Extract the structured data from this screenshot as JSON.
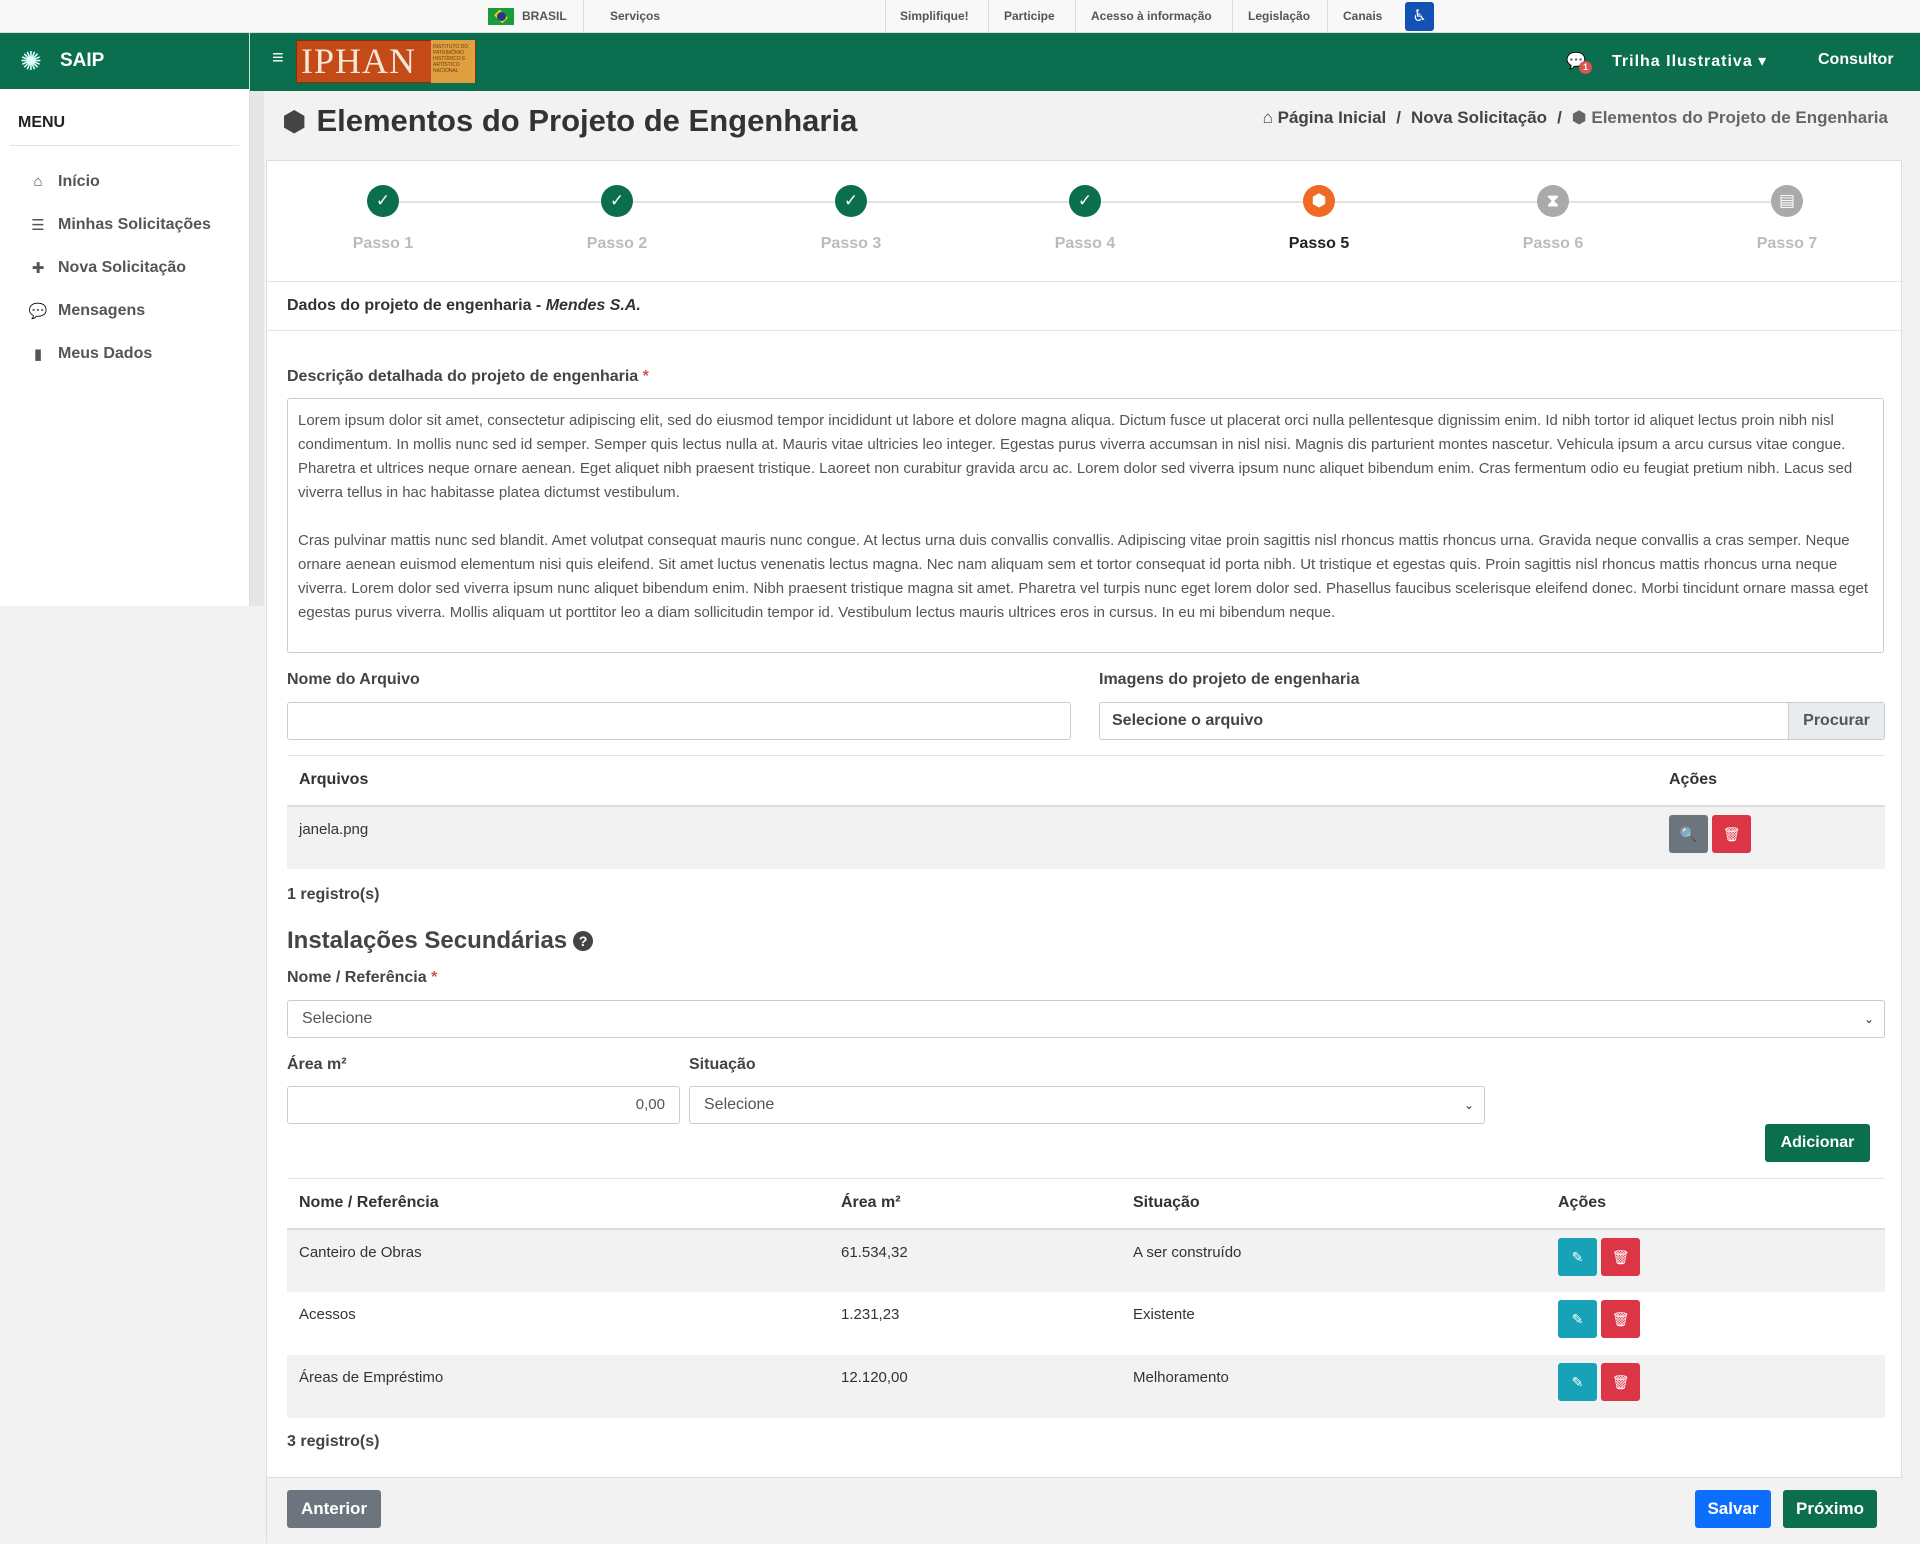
{
  "gov_bar": {
    "country": "BRASIL",
    "services": "Serviços",
    "links": [
      "Simplifique!",
      "Participe",
      "Acesso à informação",
      "Legislação",
      "Canais"
    ]
  },
  "sidebar": {
    "brand": "SAIP",
    "menu_title": "MENU",
    "items": [
      {
        "label": "Início",
        "icon": "home-icon"
      },
      {
        "label": "Minhas Solicitações",
        "icon": "list-icon"
      },
      {
        "label": "Nova Solicitação",
        "icon": "plus-icon"
      },
      {
        "label": "Mensagens",
        "icon": "comments-icon"
      },
      {
        "label": "Meus Dados",
        "icon": "file-icon"
      }
    ]
  },
  "topbar": {
    "logo_text": "IPHAN",
    "logo_subtitle": "INSTITUTO DO PATRIMÔNIO HISTÓRICO E ARTÍSTICO NACIONAL",
    "notifications": "1",
    "user_name": "Trilha Ilustrativa",
    "role": "Consultor"
  },
  "page": {
    "title": "Elementos do Projeto de Engenharia",
    "breadcrumb": [
      "Página Inicial",
      "Nova Solicitação",
      "Elementos do Projeto de Engenharia"
    ]
  },
  "steps": [
    {
      "label": "Passo 1",
      "state": "done"
    },
    {
      "label": "Passo 2",
      "state": "done"
    },
    {
      "label": "Passo 3",
      "state": "done"
    },
    {
      "label": "Passo 4",
      "state": "done"
    },
    {
      "label": "Passo 5",
      "state": "active"
    },
    {
      "label": "Passo 6",
      "state": "todo"
    },
    {
      "label": "Passo 7",
      "state": "todo"
    }
  ],
  "section": {
    "header_prefix": "Dados do projeto de engenharia - ",
    "company": "Mendes S.A."
  },
  "form": {
    "desc_label": "Descrição detalhada do projeto de engenharia",
    "desc_value": "Lorem ipsum dolor sit amet, consectetur adipiscing elit, sed do eiusmod tempor incididunt ut labore et dolore magna aliqua. Dictum fusce ut placerat orci nulla pellentesque dignissim enim. Id nibh tortor id aliquet lectus proin nibh nisl condimentum. In mollis nunc sed id semper. Semper quis lectus nulla at. Mauris vitae ultricies leo integer. Egestas purus viverra accumsan in nisl nisi. Magnis dis parturient montes nascetur. Vehicula ipsum a arcu cursus vitae congue. Pharetra et ultrices neque ornare aenean. Eget aliquet nibh praesent tristique. Laoreet non curabitur gravida arcu ac. Lorem dolor sed viverra ipsum nunc aliquet bibendum enim. Cras fermentum odio eu feugiat pretium nibh. Lacus sed viverra tellus in hac habitasse platea dictumst vestibulum.\n\nCras pulvinar mattis nunc sed blandit. Amet volutpat consequat mauris nunc congue. At lectus urna duis convallis convallis. Adipiscing vitae proin sagittis nisl rhoncus mattis rhoncus urna. Gravida neque convallis a cras semper. Neque ornare aenean euismod elementum nisi quis eleifend. Sit amet luctus venenatis lectus magna. Nec nam aliquam sem et tortor consequat id porta nibh. Ut tristique et egestas quis. Proin sagittis nisl rhoncus mattis rhoncus urna neque viverra. Lorem dolor sed viverra ipsum nunc aliquet bibendum enim. Nibh praesent tristique magna sit amet. Pharetra vel turpis nunc eget lorem dolor sed. Phasellus faucibus scelerisque eleifend donec. Morbi tincidunt ornare massa eget egestas purus viverra. Mollis aliquam ut porttitor leo a diam sollicitudin tempor id. Vestibulum lectus mauris ultrices eros in cursus. In eu mi bibendum neque.",
    "file_name_label": "Nome do Arquivo",
    "file_name_value": "",
    "images_label": "Imagens do projeto de engenharia",
    "file_picker_text": "Selecione o arquivo",
    "browse_label": "Procurar"
  },
  "files_table": {
    "headers": [
      "Arquivos",
      "Ações"
    ],
    "rows": [
      {
        "name": "janela.png"
      }
    ],
    "count": "1 registro(s)"
  },
  "installations": {
    "title": "Instalações Secundárias",
    "name_label": "Nome / Referência",
    "name_select": "Selecione",
    "area_label": "Área m²",
    "area_value": "0,00",
    "status_label": "Situação",
    "status_select": "Selecione",
    "add_label": "Adicionar",
    "headers": [
      "Nome / Referência",
      "Área m²",
      "Situação",
      "Ações"
    ],
    "rows": [
      {
        "name": "Canteiro de Obras",
        "area": "61.534,32",
        "status": "A ser construído"
      },
      {
        "name": "Acessos",
        "area": "1.231,23",
        "status": "Existente"
      },
      {
        "name": "Áreas de Empréstimo",
        "area": "12.120,00",
        "status": "Melhoramento"
      }
    ],
    "count": "3 registro(s)"
  },
  "footer": {
    "prev_label": "Anterior",
    "save_label": "Salvar",
    "next_label": "Próximo"
  },
  "colors": {
    "primary_green": "#0b6e4f",
    "active_step": "#f06a25",
    "danger": "#dc3545",
    "info": "#17a2b8",
    "save_blue": "#0d6efd"
  }
}
